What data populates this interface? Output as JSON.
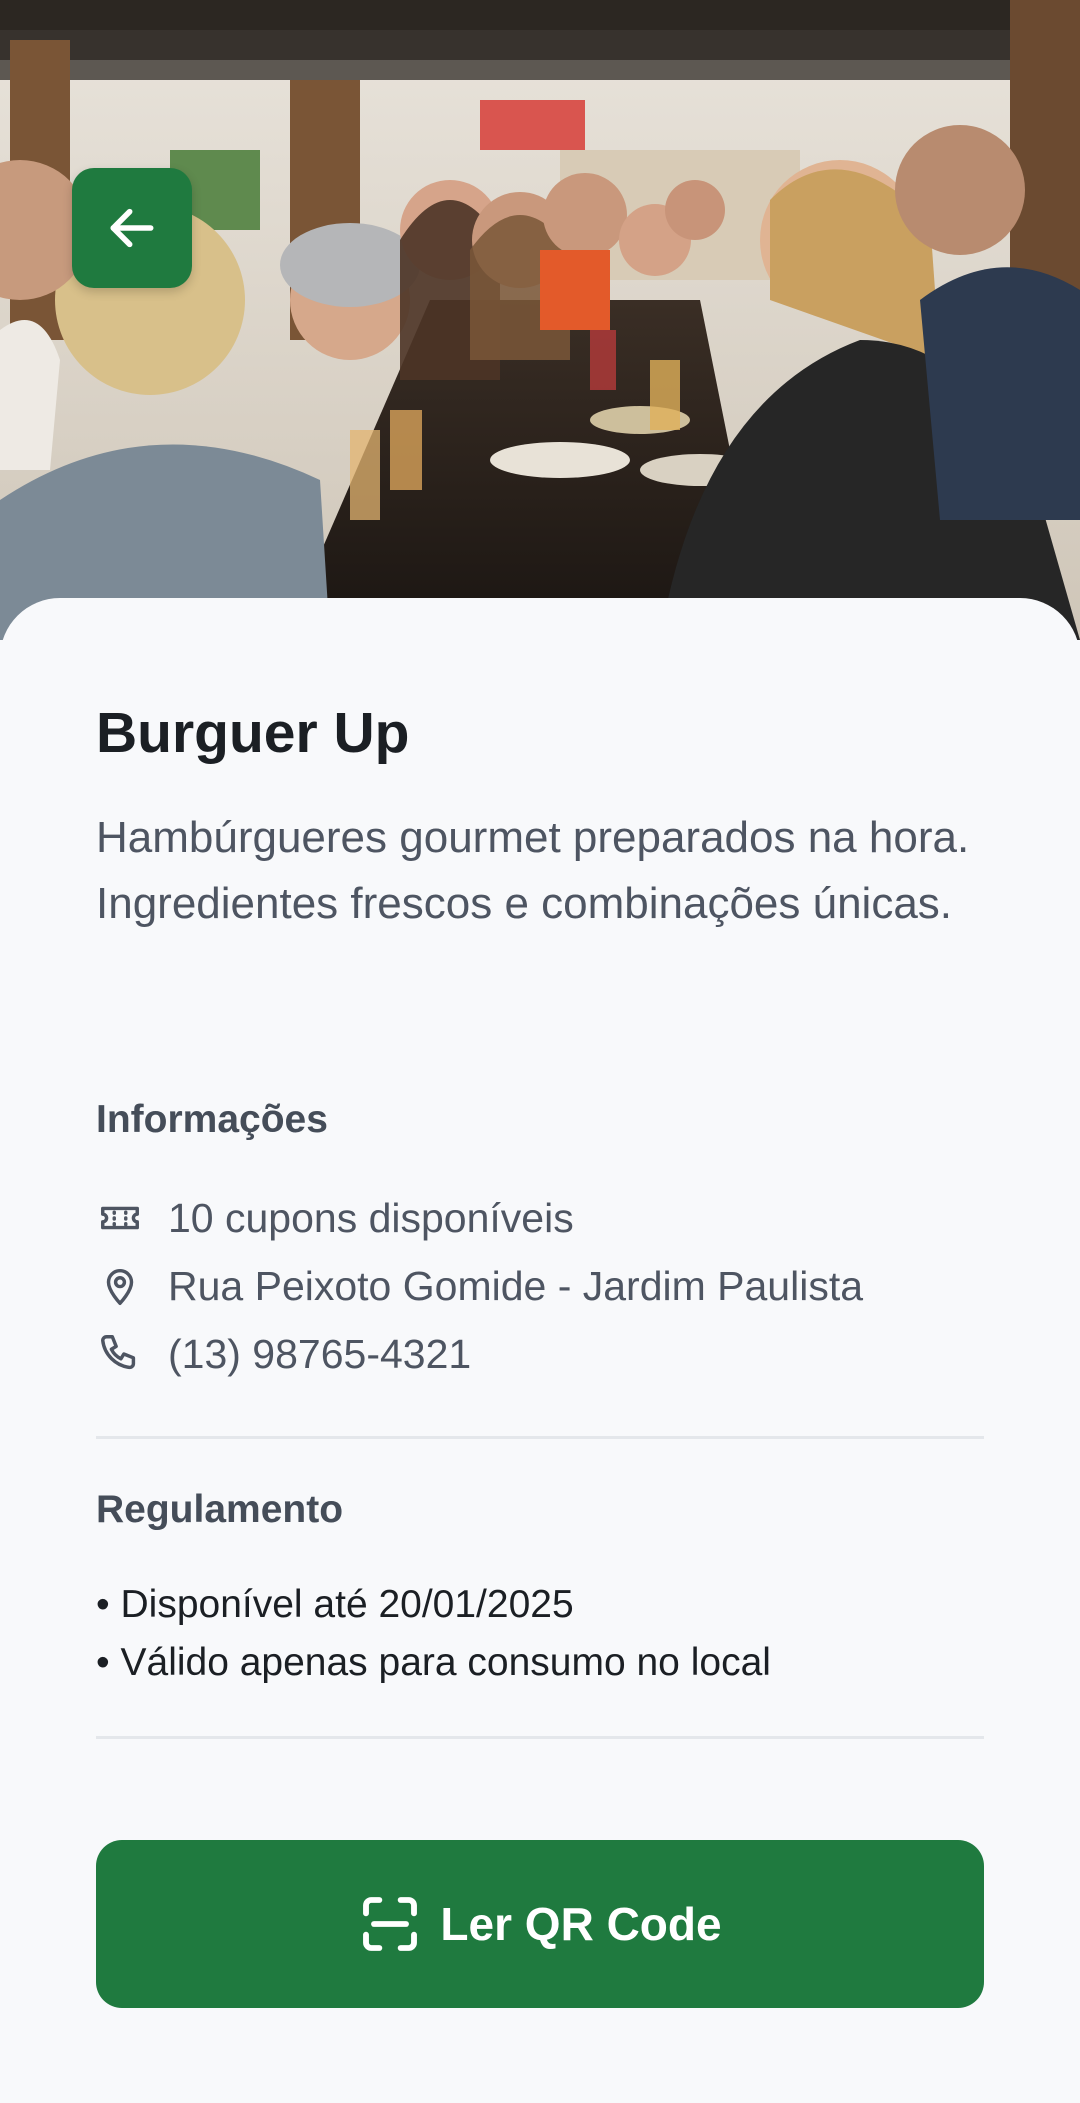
{
  "restaurant": {
    "name": "Burguer Up",
    "description": "Hambúrgueres gourmet preparados na hora. Ingredientes frescos e combinações únicas."
  },
  "info": {
    "heading": "Informações",
    "coupons": "10 cupons disponíveis",
    "address": "Rua Peixoto Gomide - Jardim Paulista",
    "phone": "(13) 98765-4321"
  },
  "rules": {
    "heading": "Regulamento",
    "items": [
      "• Disponível até 20/01/2025",
      "• Válido apenas para consumo no local"
    ]
  },
  "actions": {
    "qr_label": "Ler QR Code"
  },
  "icons": {
    "back": "arrow-left-icon",
    "coupons": "ticket-icon",
    "address": "map-pin-icon",
    "phone": "phone-icon",
    "qr": "scan-icon"
  },
  "colors": {
    "accent": "#1F7A3F",
    "background": "#F8F9FB",
    "title": "#1B1F24",
    "text_secondary": "#4E5562",
    "divider": "#E4E7EB"
  }
}
